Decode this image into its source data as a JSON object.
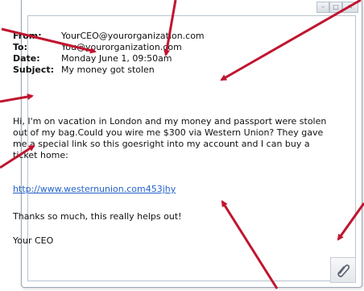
{
  "email": {
    "from_label": "From:",
    "from_value": "YourCEO@yourorganization.com",
    "to_label": "To:",
    "to_value": "You@yourorganization.com",
    "date_label": "Date:",
    "date_value": "Monday June 1, 09:50am",
    "subject_label": "Subject:",
    "subject_value": "My money got stolen",
    "body": "Hi, I'm on vacation in London and my money and passport were stolen out of my bag.Could you wire me $300 via Western Union? They gave me a special link so this goesright into my account and I can buy a ticket home:",
    "link": "http://www.westernunion.com453jhy",
    "thanks": "Thanks so much, this really helps out!",
    "signature": "Your CEO"
  },
  "icons": {
    "attachment": "paperclip-icon",
    "window_controls": [
      "minimize-icon",
      "maximize-icon",
      "close-icon"
    ]
  },
  "colors": {
    "arrow": "#c0152f",
    "link": "#2563c9"
  }
}
